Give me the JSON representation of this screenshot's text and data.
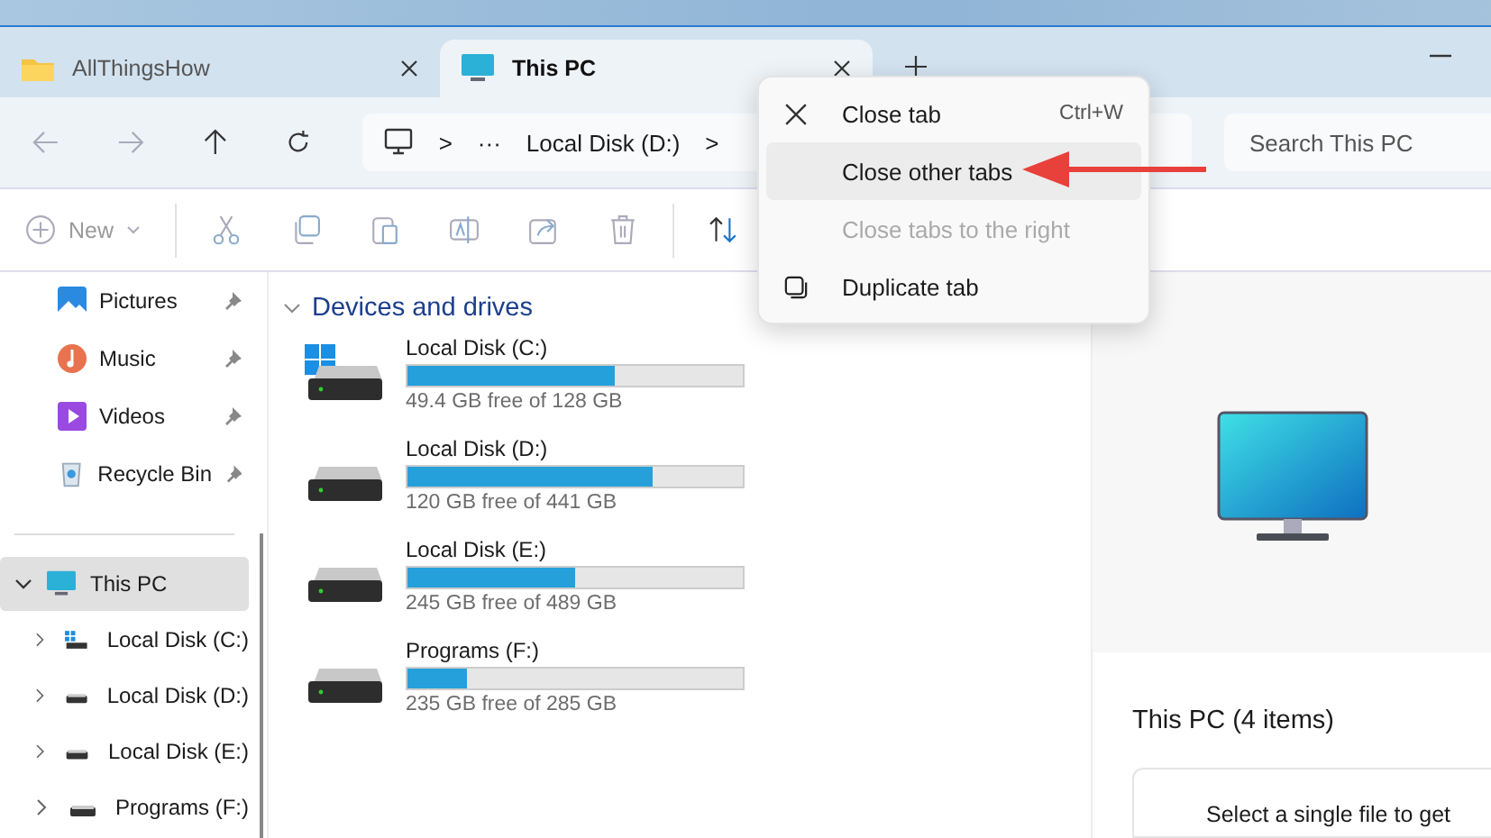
{
  "tabs": [
    {
      "label": "AllThingsHow",
      "selected": false,
      "kind": "folder"
    },
    {
      "label": "This PC",
      "selected": true,
      "kind": "pc"
    }
  ],
  "address": {
    "separator_1": ">",
    "ellipsis": "···",
    "location": "Local Disk (D:)",
    "separator_2": ">"
  },
  "search": {
    "placeholder": "Search This PC"
  },
  "toolbar": {
    "new_label": "New"
  },
  "quick_access": [
    {
      "label": "Pictures",
      "kind": "pictures"
    },
    {
      "label": "Music",
      "kind": "music"
    },
    {
      "label": "Videos",
      "kind": "videos"
    },
    {
      "label": "Recycle Bin",
      "kind": "bin"
    }
  ],
  "tree": [
    {
      "label": "This PC",
      "expanded": true,
      "selected": true,
      "children": [
        {
          "label": "Local Disk (C:)",
          "kind": "system",
          "expanded": false
        },
        {
          "label": "Local Disk (D:)",
          "kind": "disk",
          "expanded": false
        },
        {
          "label": "Local Disk (E:)",
          "kind": "disk",
          "expanded": false
        },
        {
          "label": "Programs (F:)",
          "kind": "disk",
          "expanded": false
        }
      ]
    }
  ],
  "section": {
    "title": "Devices and drives",
    "expanded": true
  },
  "drives": [
    {
      "name": "Local Disk (C:)",
      "kind": "system",
      "level": 0.62,
      "free": "49.4 GB free of 128 GB"
    },
    {
      "name": "Local Disk (D:)",
      "kind": "disk",
      "level": 0.73,
      "free": "120 GB free of 441 GB"
    },
    {
      "name": "Local Disk (E:)",
      "kind": "disk",
      "level": 0.5,
      "free": "245 GB free of 489 GB"
    },
    {
      "name": "Programs (F:)",
      "kind": "disk",
      "level": 0.18,
      "free": "235 GB free of 285 GB"
    }
  ],
  "details": {
    "title": "This PC (4 items)",
    "hint": "Select a single file to get"
  },
  "context_menu": [
    {
      "label": "Close tab",
      "kind": "close",
      "shortcut": "Ctrl+W",
      "selected": false,
      "disabled": false
    },
    {
      "label": "Close other tabs",
      "kind": "plain",
      "selected": true,
      "disabled": false
    },
    {
      "label": "Close tabs to the right",
      "kind": "plain",
      "selected": false,
      "disabled": true
    },
    {
      "label": "Duplicate tab",
      "kind": "duplicate",
      "selected": false,
      "disabled": false
    }
  ]
}
